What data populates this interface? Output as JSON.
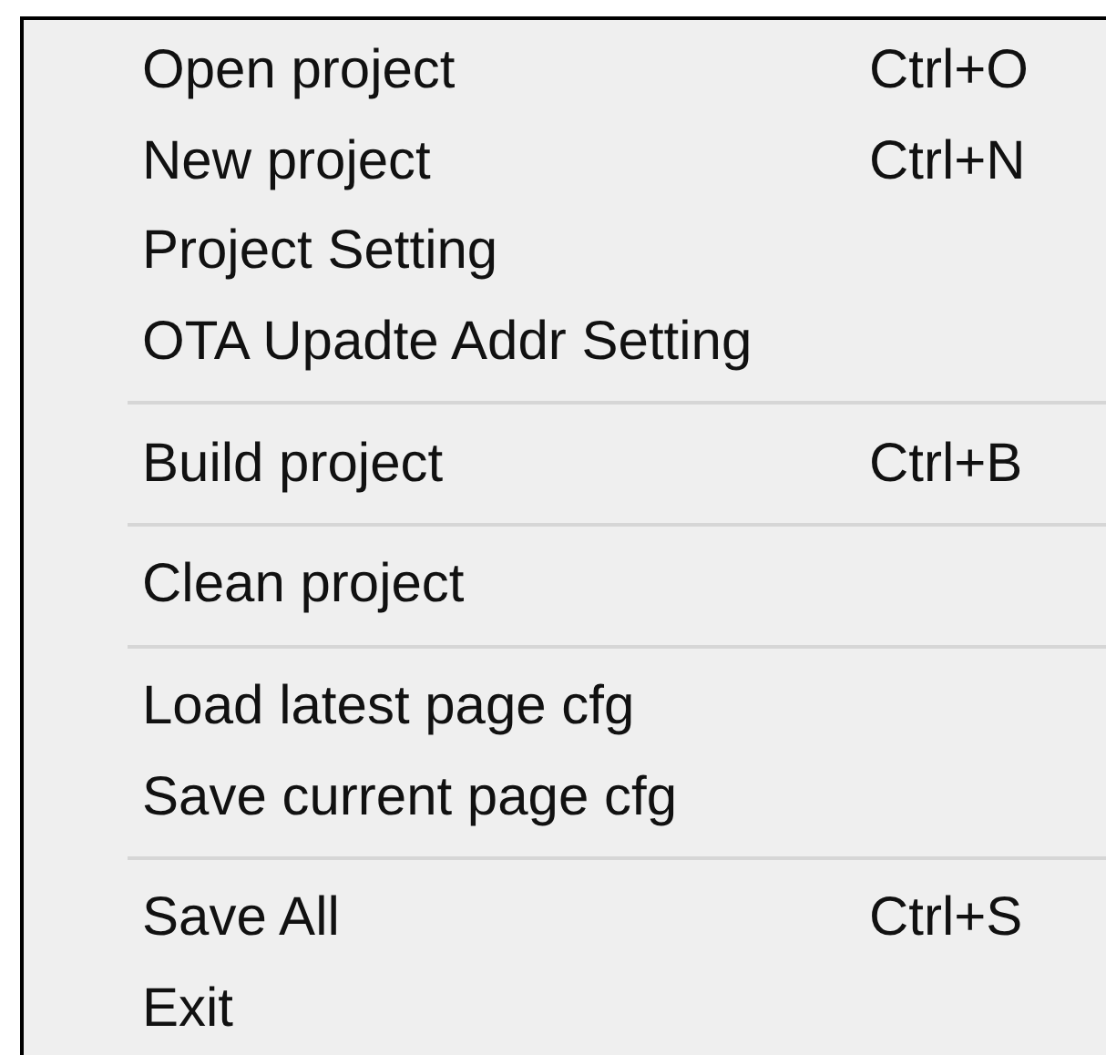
{
  "menu": {
    "items": [
      {
        "kind": "item",
        "label": "Open project",
        "shortcut": "Ctrl+O"
      },
      {
        "kind": "item",
        "label": "New project",
        "shortcut": "Ctrl+N"
      },
      {
        "kind": "item",
        "label": "Project Setting"
      },
      {
        "kind": "item",
        "label": "OTA Upadte Addr Setting"
      },
      {
        "kind": "separator"
      },
      {
        "kind": "item",
        "label": "Build project",
        "shortcut": "Ctrl+B"
      },
      {
        "kind": "separator"
      },
      {
        "kind": "item",
        "label": "Clean project"
      },
      {
        "kind": "separator"
      },
      {
        "kind": "item",
        "label": "Load latest page cfg"
      },
      {
        "kind": "item",
        "label": "Save current page cfg"
      },
      {
        "kind": "separator"
      },
      {
        "kind": "item",
        "label": "Save All",
        "shortcut": "Ctrl+S"
      },
      {
        "kind": "item",
        "label": "Exit"
      }
    ]
  }
}
